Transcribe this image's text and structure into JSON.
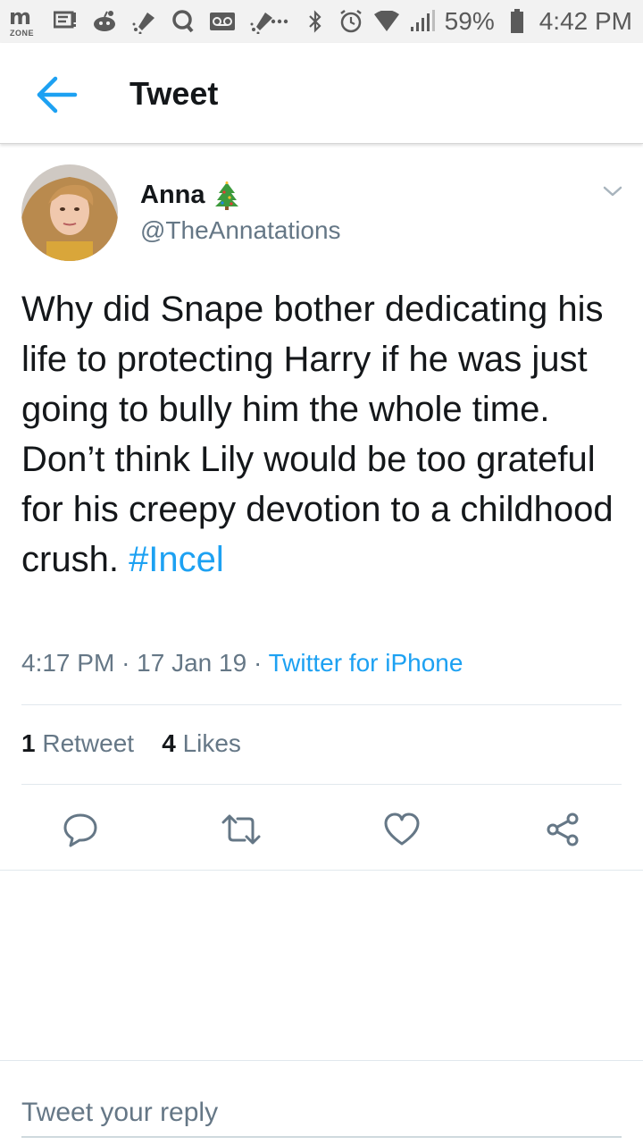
{
  "status_bar": {
    "battery": "59%",
    "time": "4:42 PM",
    "mzone_label": "ZONE",
    "icons": [
      "mzone-icon",
      "message-icon",
      "reddit-icon",
      "pin-icon",
      "search-app-icon",
      "voicemail-icon",
      "pin-icon",
      "more-icon",
      "bluetooth-icon",
      "alarm-icon",
      "wifi-icon",
      "signal-icon",
      "battery-icon"
    ]
  },
  "header": {
    "title": "Tweet"
  },
  "tweet": {
    "author_name": "Anna",
    "author_handle": "@TheAnnatations",
    "text": "Why did Snape bother dedicating his life to protecting Harry if he was just going to bully him the whole time. Don’t think Lily would be too grateful for his creepy devotion to a childhood crush.",
    "hashtag": "#Incel",
    "time": "4:17 PM",
    "date": "17 Jan 19",
    "source": "Twitter for iPhone",
    "retweet_count": "1",
    "retweet_label": "Retweet",
    "like_count": "4",
    "like_label": "Likes"
  },
  "reply": {
    "placeholder": "Tweet your reply"
  },
  "colors": {
    "accent": "#1da1f2",
    "secondary_text": "#657786",
    "primary_text": "#14171a",
    "divider": "#e1e8ed"
  }
}
